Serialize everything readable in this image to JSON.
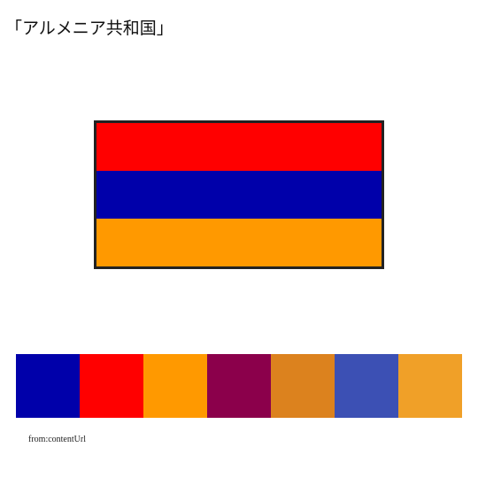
{
  "title": "「アルメニア共和国」",
  "flag": {
    "stripes": [
      "#ff0000",
      "#0000aa",
      "#ff9900"
    ]
  },
  "palette": [
    "#0000aa",
    "#ff0000",
    "#ff9900",
    "#8b004b",
    "#dc821e",
    "#3c50b4",
    "#f0a028"
  ],
  "source_label": "from:contentUrl"
}
